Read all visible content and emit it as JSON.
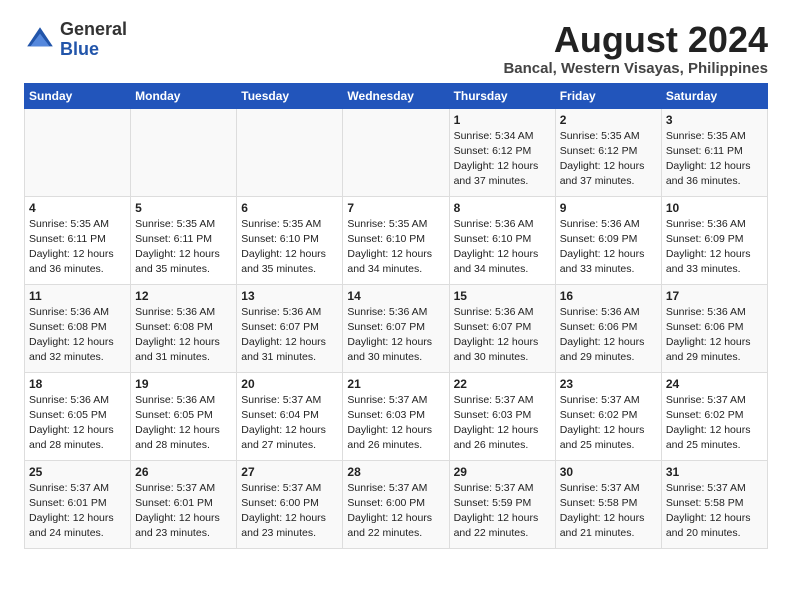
{
  "header": {
    "logo_general": "General",
    "logo_blue": "Blue",
    "month_year": "August 2024",
    "location": "Bancal, Western Visayas, Philippines"
  },
  "weekdays": [
    "Sunday",
    "Monday",
    "Tuesday",
    "Wednesday",
    "Thursday",
    "Friday",
    "Saturday"
  ],
  "weeks": [
    [
      {
        "day": "",
        "content": ""
      },
      {
        "day": "",
        "content": ""
      },
      {
        "day": "",
        "content": ""
      },
      {
        "day": "",
        "content": ""
      },
      {
        "day": "1",
        "content": "Sunrise: 5:34 AM\nSunset: 6:12 PM\nDaylight: 12 hours\nand 37 minutes."
      },
      {
        "day": "2",
        "content": "Sunrise: 5:35 AM\nSunset: 6:12 PM\nDaylight: 12 hours\nand 37 minutes."
      },
      {
        "day": "3",
        "content": "Sunrise: 5:35 AM\nSunset: 6:11 PM\nDaylight: 12 hours\nand 36 minutes."
      }
    ],
    [
      {
        "day": "4",
        "content": "Sunrise: 5:35 AM\nSunset: 6:11 PM\nDaylight: 12 hours\nand 36 minutes."
      },
      {
        "day": "5",
        "content": "Sunrise: 5:35 AM\nSunset: 6:11 PM\nDaylight: 12 hours\nand 35 minutes."
      },
      {
        "day": "6",
        "content": "Sunrise: 5:35 AM\nSunset: 6:10 PM\nDaylight: 12 hours\nand 35 minutes."
      },
      {
        "day": "7",
        "content": "Sunrise: 5:35 AM\nSunset: 6:10 PM\nDaylight: 12 hours\nand 34 minutes."
      },
      {
        "day": "8",
        "content": "Sunrise: 5:36 AM\nSunset: 6:10 PM\nDaylight: 12 hours\nand 34 minutes."
      },
      {
        "day": "9",
        "content": "Sunrise: 5:36 AM\nSunset: 6:09 PM\nDaylight: 12 hours\nand 33 minutes."
      },
      {
        "day": "10",
        "content": "Sunrise: 5:36 AM\nSunset: 6:09 PM\nDaylight: 12 hours\nand 33 minutes."
      }
    ],
    [
      {
        "day": "11",
        "content": "Sunrise: 5:36 AM\nSunset: 6:08 PM\nDaylight: 12 hours\nand 32 minutes."
      },
      {
        "day": "12",
        "content": "Sunrise: 5:36 AM\nSunset: 6:08 PM\nDaylight: 12 hours\nand 31 minutes."
      },
      {
        "day": "13",
        "content": "Sunrise: 5:36 AM\nSunset: 6:07 PM\nDaylight: 12 hours\nand 31 minutes."
      },
      {
        "day": "14",
        "content": "Sunrise: 5:36 AM\nSunset: 6:07 PM\nDaylight: 12 hours\nand 30 minutes."
      },
      {
        "day": "15",
        "content": "Sunrise: 5:36 AM\nSunset: 6:07 PM\nDaylight: 12 hours\nand 30 minutes."
      },
      {
        "day": "16",
        "content": "Sunrise: 5:36 AM\nSunset: 6:06 PM\nDaylight: 12 hours\nand 29 minutes."
      },
      {
        "day": "17",
        "content": "Sunrise: 5:36 AM\nSunset: 6:06 PM\nDaylight: 12 hours\nand 29 minutes."
      }
    ],
    [
      {
        "day": "18",
        "content": "Sunrise: 5:36 AM\nSunset: 6:05 PM\nDaylight: 12 hours\nand 28 minutes."
      },
      {
        "day": "19",
        "content": "Sunrise: 5:36 AM\nSunset: 6:05 PM\nDaylight: 12 hours\nand 28 minutes."
      },
      {
        "day": "20",
        "content": "Sunrise: 5:37 AM\nSunset: 6:04 PM\nDaylight: 12 hours\nand 27 minutes."
      },
      {
        "day": "21",
        "content": "Sunrise: 5:37 AM\nSunset: 6:03 PM\nDaylight: 12 hours\nand 26 minutes."
      },
      {
        "day": "22",
        "content": "Sunrise: 5:37 AM\nSunset: 6:03 PM\nDaylight: 12 hours\nand 26 minutes."
      },
      {
        "day": "23",
        "content": "Sunrise: 5:37 AM\nSunset: 6:02 PM\nDaylight: 12 hours\nand 25 minutes."
      },
      {
        "day": "24",
        "content": "Sunrise: 5:37 AM\nSunset: 6:02 PM\nDaylight: 12 hours\nand 25 minutes."
      }
    ],
    [
      {
        "day": "25",
        "content": "Sunrise: 5:37 AM\nSunset: 6:01 PM\nDaylight: 12 hours\nand 24 minutes."
      },
      {
        "day": "26",
        "content": "Sunrise: 5:37 AM\nSunset: 6:01 PM\nDaylight: 12 hours\nand 23 minutes."
      },
      {
        "day": "27",
        "content": "Sunrise: 5:37 AM\nSunset: 6:00 PM\nDaylight: 12 hours\nand 23 minutes."
      },
      {
        "day": "28",
        "content": "Sunrise: 5:37 AM\nSunset: 6:00 PM\nDaylight: 12 hours\nand 22 minutes."
      },
      {
        "day": "29",
        "content": "Sunrise: 5:37 AM\nSunset: 5:59 PM\nDaylight: 12 hours\nand 22 minutes."
      },
      {
        "day": "30",
        "content": "Sunrise: 5:37 AM\nSunset: 5:58 PM\nDaylight: 12 hours\nand 21 minutes."
      },
      {
        "day": "31",
        "content": "Sunrise: 5:37 AM\nSunset: 5:58 PM\nDaylight: 12 hours\nand 20 minutes."
      }
    ]
  ]
}
